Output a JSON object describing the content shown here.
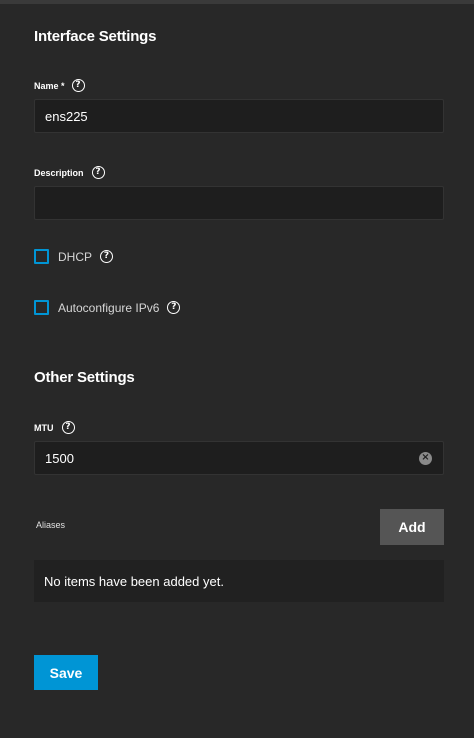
{
  "interface_settings": {
    "title": "Interface Settings",
    "name": {
      "label": "Name *",
      "value": "ens225"
    },
    "description": {
      "label": "Description",
      "value": ""
    },
    "dhcp": {
      "label": "DHCP",
      "checked": false
    },
    "autoconfigure_ipv6": {
      "label": "Autoconfigure IPv6",
      "checked": false
    }
  },
  "other_settings": {
    "title": "Other Settings",
    "mtu": {
      "label": "MTU",
      "value": "1500"
    }
  },
  "aliases": {
    "label": "Aliases",
    "add_label": "Add",
    "empty_text": "No items have been added yet."
  },
  "actions": {
    "save_label": "Save"
  },
  "colors": {
    "accent": "#0095d5",
    "background": "#282828",
    "input_bg": "#1e1e1e"
  },
  "icons": {
    "help": "help-circle-icon",
    "clear": "clear-circle-icon"
  }
}
